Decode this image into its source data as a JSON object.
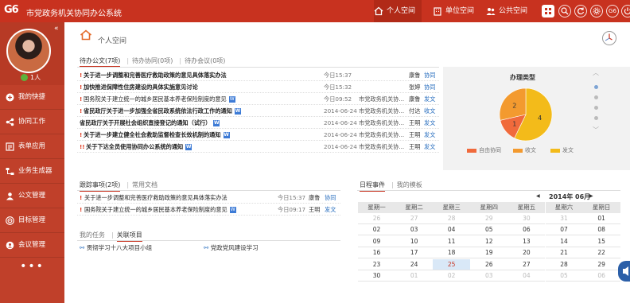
{
  "app": {
    "logo": "G6",
    "title": "市党政务机关协同办公系统"
  },
  "topnav": [
    {
      "label": "个人空间",
      "icon": "home-icon",
      "active": true
    },
    {
      "label": "单位空间",
      "icon": "building-icon",
      "active": false
    },
    {
      "label": "公共空间",
      "icon": "group-icon",
      "active": false
    }
  ],
  "toolbar_icons": [
    "grid-icon",
    "search-icon",
    "refresh-icon",
    "settings-icon",
    "g6-icon",
    "power-icon"
  ],
  "toolbar_labels": {
    "g6": "G6"
  },
  "sidebar": {
    "user": "1人",
    "items": [
      {
        "label": "我的快捷",
        "icon": "plus-circle-icon"
      },
      {
        "label": "协同工作",
        "icon": "share-icon"
      },
      {
        "label": "表单应用",
        "icon": "form-icon"
      },
      {
        "label": "业务生成器",
        "icon": "flow-icon"
      },
      {
        "label": "公文管理",
        "icon": "person-icon"
      },
      {
        "label": "目标管理",
        "icon": "target-icon"
      },
      {
        "label": "会议管理",
        "icon": "meeting-icon"
      }
    ],
    "more": "•••"
  },
  "breadcrumb": {
    "label": "个人空间"
  },
  "todo": {
    "tabs": [
      "待办公文(7项)",
      "待办协同(0项)",
      "待办会议(0项)"
    ],
    "rows": [
      {
        "mark": "!",
        "title": "关于进一步调整和完善医疗救助政策的意见具体落实办法",
        "bold": true,
        "doc": false,
        "time": "今日15:37",
        "org": "",
        "person": "康鲁",
        "type": "协同"
      },
      {
        "mark": "!",
        "title": "加快推进保障性住房建设的具体实施意见讨论",
        "bold": true,
        "doc": false,
        "time": "今日15:32",
        "org": "",
        "person": "张婷",
        "type": "协同"
      },
      {
        "mark": "!",
        "title": "国务院关于建立统一的城乡居民基本养老保险制度的意见",
        "bold": false,
        "doc": true,
        "time": "今日09:52",
        "org": "市党政务机关协...",
        "person": "康鲁",
        "type": "发文"
      },
      {
        "mark": "!",
        "title": "省民政厅关于进一步加强全省民政系统依法行政工作的通知",
        "bold": true,
        "doc": true,
        "time": "2014-06-24",
        "org": "市党政务机关协...",
        "person": "付达",
        "type": "收文"
      },
      {
        "mark": "",
        "title": "省民政厅关于开展社会组织直接登记的通知（试行）",
        "bold": true,
        "doc": true,
        "time": "2014-06-24",
        "org": "市党政务机关协...",
        "person": "王明",
        "type": "发文"
      },
      {
        "mark": "!",
        "title": "关于进一步建立健全社会救助监督检查长效机制的通知",
        "bold": true,
        "doc": true,
        "time": "2014-06-24",
        "org": "市党政务机关协...",
        "person": "王明",
        "type": "发文"
      },
      {
        "mark": "!!",
        "title": "关于下达全员使用协同办公系统的通知",
        "bold": true,
        "doc": true,
        "time": "2014-06-24",
        "org": "市党政务机关协...",
        "person": "王明",
        "type": "发文"
      }
    ]
  },
  "chart_data": {
    "type": "pie",
    "title": "办理类型",
    "categories": [
      "自由协同",
      "收文",
      "发文"
    ],
    "values": [
      1,
      2,
      4
    ],
    "colors": [
      "#f06a3c",
      "#f39a2f",
      "#f3bb1a"
    ],
    "legend": "bottom"
  },
  "tracking": {
    "tabs": [
      "跟踪事项(2项)",
      "常用文档"
    ],
    "rows": [
      {
        "mark": "!",
        "title": "关于进一步调整和完善医疗救助政策的意见具体落实办法",
        "doc": false,
        "time": "今日15:37",
        "person": "康鲁",
        "type": "协同"
      },
      {
        "mark": "!",
        "title": "国务院关于建立统一的城乡居民基本养老保险制度的意见",
        "doc": true,
        "time": "今日09:17",
        "person": "王明",
        "type": "发文"
      }
    ]
  },
  "tasks": {
    "tabs": [
      "我的任务",
      "关联项目"
    ],
    "items": [
      "贯彻学习十八大项目小组",
      "党政党风建设学习"
    ]
  },
  "calendar": {
    "tabs": [
      "日程事件",
      "我的模板"
    ],
    "prev": "◀",
    "next": "▶",
    "month_label": "2014年 06月",
    "weekdays": [
      "星期一",
      "星期二",
      "星期三",
      "星期四",
      "星期五",
      "星期六",
      "星期日"
    ],
    "weeks": [
      [
        "26",
        "27",
        "28",
        "29",
        "30",
        "31",
        "01"
      ],
      [
        "02",
        "03",
        "04",
        "05",
        "06",
        "07",
        "08"
      ],
      [
        "09",
        "10",
        "11",
        "12",
        "13",
        "14",
        "15"
      ],
      [
        "16",
        "17",
        "18",
        "19",
        "20",
        "21",
        "22"
      ],
      [
        "23",
        "24",
        "25",
        "26",
        "27",
        "28",
        "29"
      ],
      [
        "30",
        "01",
        "02",
        "03",
        "04",
        "05",
        "06"
      ]
    ],
    "today": "25"
  }
}
